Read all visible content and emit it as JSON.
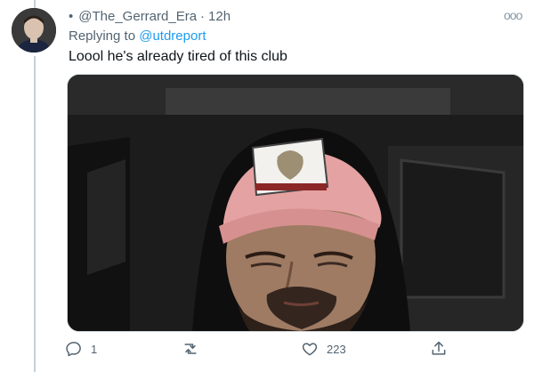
{
  "tweet": {
    "bullet": "•",
    "handle": "@The_Gerrard_Era",
    "separator": "·",
    "time": "12h",
    "replying_prefix": "Replying to",
    "replying_handle": "@utdreport",
    "text": "Loool he's already tired of this club",
    "more_label": "ooo",
    "media_icon": "photo-of-man-in-pink-cap",
    "stats": {
      "replies": "1",
      "likes": "223"
    }
  },
  "colors": {
    "link": "#1d9bf0",
    "muted": "#536471",
    "cap": "#e4a2a2"
  }
}
